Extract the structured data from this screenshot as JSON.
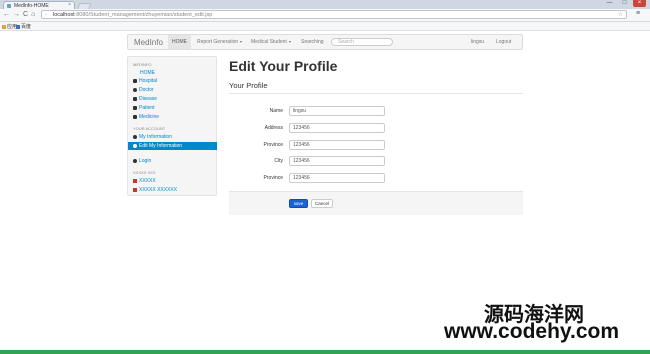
{
  "browser": {
    "tab_title": "MedInfo-HOME",
    "tab_close": "×",
    "url_host": "localhost",
    "url_path": ":8080/Student_management/zhuyemian/student_edit.jsp",
    "window_buttons": [
      "—",
      "□",
      "×"
    ],
    "nav_icons": [
      "←",
      "→",
      "C",
      "⌂"
    ],
    "bookmarks": [
      "应用",
      "百度"
    ]
  },
  "navbar": {
    "brand": "MedInfo",
    "items": [
      {
        "label": "HOME",
        "active": true
      },
      {
        "label": "Report Generation",
        "dropdown": true
      },
      {
        "label": "Medical Student",
        "dropdown": true
      },
      {
        "label": "Searching"
      }
    ],
    "search_placeholder": "Search",
    "user": "lingxu",
    "logout": "Logout"
  },
  "sidebar": {
    "sections": [
      {
        "header": "MEDINFO",
        "items": [
          {
            "label": "HOME",
            "icon": "none"
          },
          {
            "label": "Hospital",
            "icon": "folder-icon"
          },
          {
            "label": "Doctor",
            "icon": "gear-icon"
          },
          {
            "label": "Disease",
            "icon": "database-icon"
          },
          {
            "label": "Patient",
            "icon": "file-icon"
          },
          {
            "label": "Medicine",
            "icon": "calendar-icon"
          }
        ]
      },
      {
        "header": "YOUR ACCOUNT",
        "items": [
          {
            "label": "My Information",
            "icon": "user-icon"
          },
          {
            "label": "Edit My Information",
            "icon": "info-icon",
            "active": true
          }
        ]
      },
      {
        "header": "",
        "items": [
          {
            "label": "Login",
            "icon": "info-icon"
          }
        ]
      },
      {
        "header": "XXXXX XXX",
        "items": [
          {
            "label": "XXXXX",
            "icon": "flag-icon"
          },
          {
            "label": "XXXXX XXXXXX",
            "icon": "flag-icon"
          }
        ]
      }
    ]
  },
  "main": {
    "title": "Edit Your Profile",
    "subtitle": "Your Profile",
    "fields": [
      {
        "label": "Name",
        "value": "lingxu"
      },
      {
        "label": "Address",
        "value": "123456"
      },
      {
        "label": "Province",
        "value": "123456"
      },
      {
        "label": "City",
        "value": "123456"
      },
      {
        "label": "Province",
        "value": "123456"
      }
    ],
    "save_label": "save",
    "cancel_label": "Cancel"
  },
  "watermark": {
    "line1": "源码海洋网",
    "line2": "www.codehy.com"
  },
  "colors": {
    "accent": "#0088cc",
    "primary_button": "#1a64d6",
    "taskbar": "#33a34f"
  }
}
